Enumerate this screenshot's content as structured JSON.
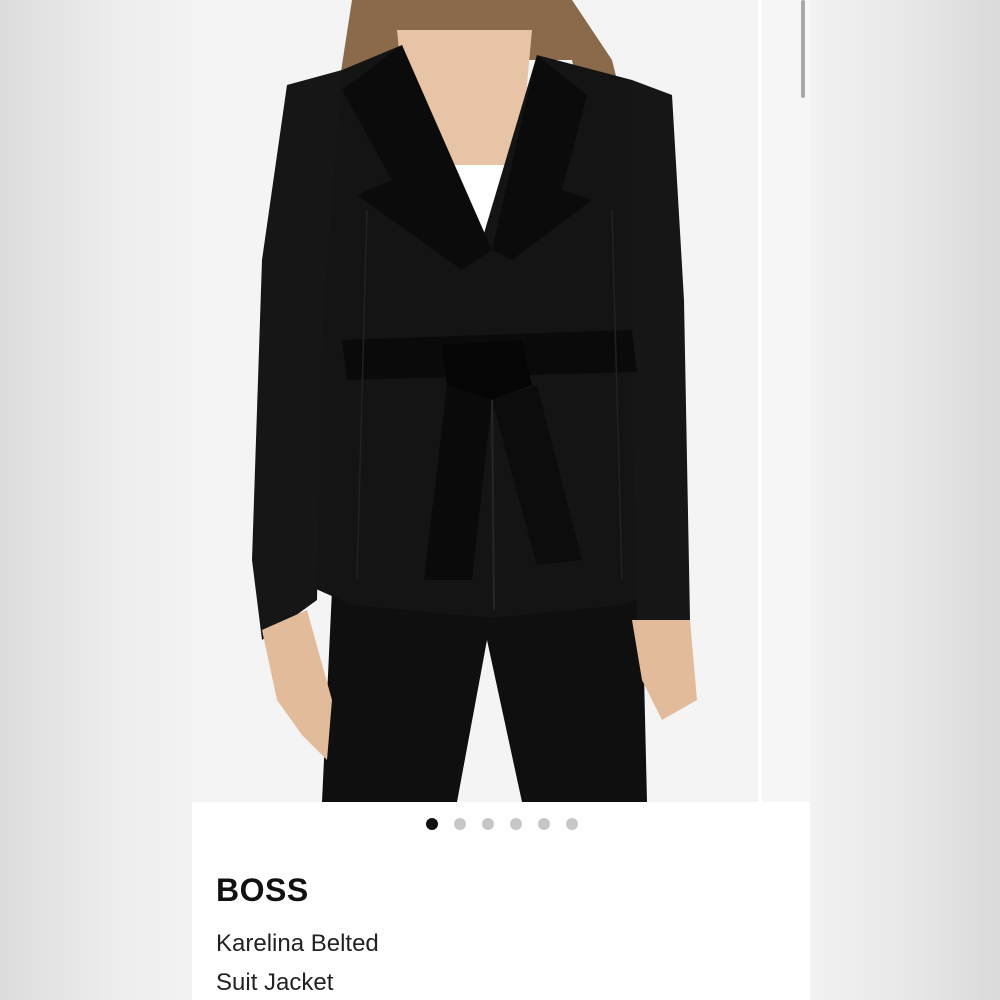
{
  "product": {
    "brand": "BOSS",
    "name_line1": "Karelina Belted",
    "name_line2": "Suit Jacket",
    "image_alt": "Model wearing black belted suit jacket"
  },
  "carousel": {
    "total_images": 6,
    "active_index": 0
  },
  "colors": {
    "jacket": "#111111",
    "background": "#f4f4f4",
    "dot_active": "#111111",
    "dot_inactive": "#c7c7c7"
  }
}
